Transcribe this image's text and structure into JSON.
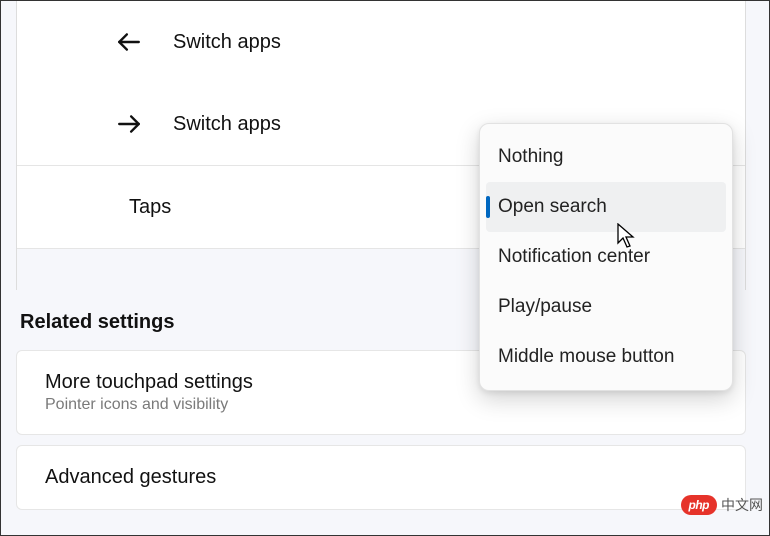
{
  "gestures": {
    "left": {
      "label": "Switch apps"
    },
    "right": {
      "label": "Switch apps"
    },
    "taps": {
      "label": "Taps"
    }
  },
  "dropdown": {
    "options": [
      {
        "label": "Nothing"
      },
      {
        "label": "Open search"
      },
      {
        "label": "Notification center"
      },
      {
        "label": "Play/pause"
      },
      {
        "label": "Middle mouse button"
      }
    ]
  },
  "related": {
    "header": "Related settings",
    "more": {
      "title": "More touchpad settings",
      "sub": "Pointer icons and visibility"
    },
    "advanced": {
      "title": "Advanced gestures"
    }
  },
  "watermark": {
    "logo": "php",
    "text": "中文网"
  }
}
